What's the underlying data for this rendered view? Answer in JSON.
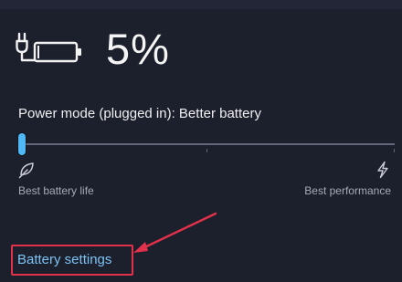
{
  "battery": {
    "percent_label": "5%",
    "charging": true,
    "level_fraction": 0.05,
    "icon": "battery-plugged-icon"
  },
  "power_mode": {
    "label": "Power mode (plugged in): Better battery",
    "slider": {
      "value_fraction": 0.0,
      "tick_fractions": [
        0.5,
        1.0
      ],
      "min_label": "Best battery life",
      "max_label": "Best performance",
      "min_icon": "leaf-icon",
      "max_icon": "lightning-icon"
    }
  },
  "settings_link": {
    "label": "Battery settings",
    "highlighted": true
  },
  "colors": {
    "background": "#1c1f2c",
    "text": "#f2f2f2",
    "accent": "#4fb8f5",
    "link": "#7cc3f4",
    "muted_text": "#a8abb6",
    "highlight": "#e2314a"
  }
}
